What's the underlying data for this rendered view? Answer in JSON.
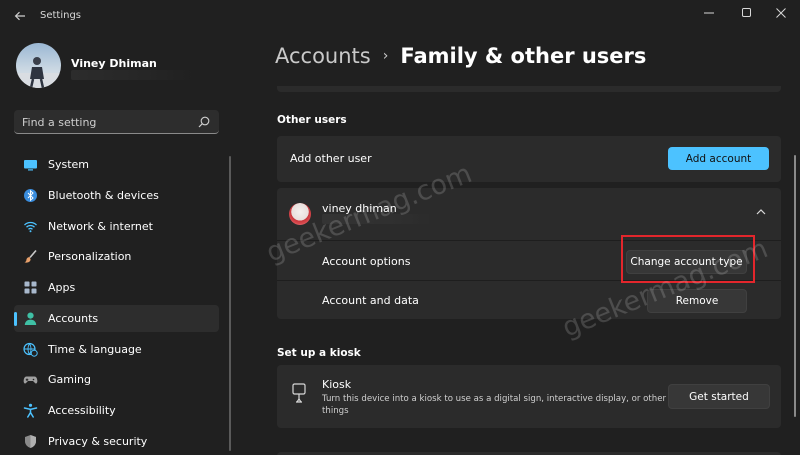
{
  "window": {
    "title": "Settings",
    "back_icon": "arrow-left-icon",
    "controls": [
      "minimize-icon",
      "maximize-icon",
      "close-icon"
    ]
  },
  "profile": {
    "name": "Viney Dhiman"
  },
  "search": {
    "placeholder": "Find a setting",
    "icon": "search-icon"
  },
  "sidebar": {
    "items": [
      {
        "label": "System",
        "icon": "system-icon",
        "color": "#4cc2ff",
        "active": false
      },
      {
        "label": "Bluetooth & devices",
        "icon": "bluetooth-icon",
        "color": "#3a8dde",
        "active": false
      },
      {
        "label": "Network & internet",
        "icon": "wifi-icon",
        "color": "#4cc2ff",
        "active": false
      },
      {
        "label": "Personalization",
        "icon": "brush-icon",
        "color": "#e8a06b",
        "active": false
      },
      {
        "label": "Apps",
        "icon": "apps-icon",
        "color": "#a8b8cc",
        "active": false
      },
      {
        "label": "Accounts",
        "icon": "person-icon",
        "color": "#3fc0a5",
        "active": true
      },
      {
        "label": "Time & language",
        "icon": "globe-clock-icon",
        "color": "#4cc2ff",
        "active": false
      },
      {
        "label": "Gaming",
        "icon": "gamepad-icon",
        "color": "#a0a0a0",
        "active": false
      },
      {
        "label": "Accessibility",
        "icon": "accessibility-icon",
        "color": "#4cc2ff",
        "active": false
      },
      {
        "label": "Privacy & security",
        "icon": "shield-icon",
        "color": "#8a8a8a",
        "active": false
      }
    ]
  },
  "main": {
    "breadcrumb": {
      "parent": "Accounts",
      "separator": "›",
      "current": "Family & other users"
    },
    "other_users": {
      "section_title": "Other users",
      "add_user_label": "Add other user",
      "add_account_button": "Add account",
      "user": {
        "name": "viney dhiman",
        "expanded": true,
        "account_options_label": "Account options",
        "change_type_button": "Change account type",
        "account_data_label": "Account and data",
        "remove_button": "Remove"
      }
    },
    "kiosk": {
      "section_title": "Set up a kiosk",
      "title": "Kiosk",
      "description": "Turn this device into a kiosk to use as a digital sign, interactive display, or other things",
      "button": "Get started",
      "icon": "kiosk-icon"
    }
  },
  "watermark": {
    "text": "geekermag.com"
  },
  "colors": {
    "accent": "#4cc2ff",
    "background": "#202020",
    "card": "#2b2b2b",
    "highlight": "#e3262c"
  }
}
